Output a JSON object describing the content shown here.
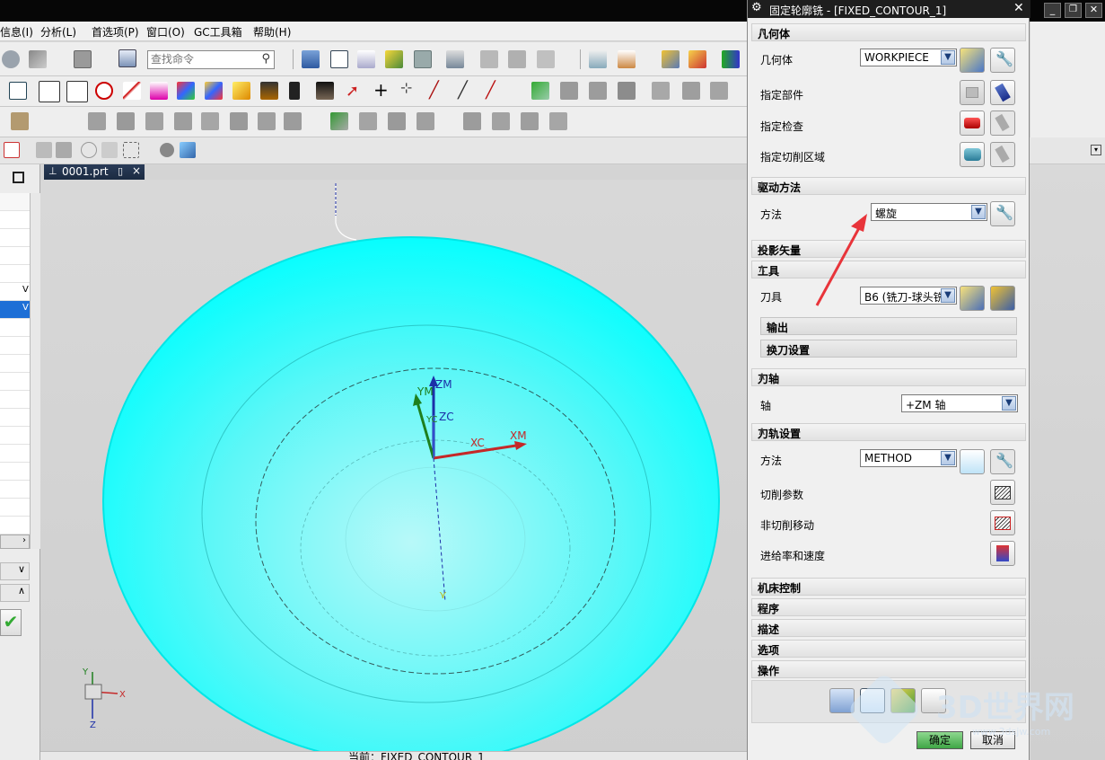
{
  "menu": {
    "items": [
      "信息(I)",
      "分析(L)",
      "首选项(P)",
      "窗口(O)",
      "GC工具箱",
      "帮助(H)"
    ]
  },
  "toolbar": {
    "search_placeholder": "查找命令"
  },
  "tab": {
    "name": "0001.prt"
  },
  "left_panel": {
    "marker1": "V",
    "marker2": "V"
  },
  "viewport": {
    "axes": {
      "zm": "ZM",
      "ym": "YM",
      "zc": "ZC",
      "xc": "XC",
      "xm": "XM",
      "yc": "YC"
    },
    "triad": {
      "x": "X",
      "y": "Y",
      "z": "Z"
    }
  },
  "status": {
    "text": "当前：FIXED_CONTOUR_1"
  },
  "watermark": {
    "text": "3D世界网",
    "url": "www.3dsjw.com"
  },
  "dialog": {
    "title": "固定轮廓铣 - [FIXED_CONTOUR_1]",
    "close_glyph": "✕",
    "sections": {
      "geometry": {
        "title": "几何体",
        "geometry_label": "几何体",
        "geometry_value": "WORKPIECE",
        "part_label": "指定部件",
        "check_label": "指定检查",
        "cut_area_label": "指定切削区域"
      },
      "drive": {
        "title": "驱动方法",
        "method_label": "方法",
        "method_value": "螺旋"
      },
      "projection": {
        "title": "投影矢量"
      },
      "tool": {
        "title": "工具",
        "tool_label": "刀具",
        "tool_value": "B6 (铣刀-球头铣",
        "output": "输出",
        "tool_change": "换刀设置"
      },
      "axis": {
        "title": "刀轴",
        "axis_label": "轴",
        "axis_value": "+ZM 轴"
      },
      "path": {
        "title": "刀轨设置",
        "method_label": "方法",
        "method_value": "METHOD",
        "cut_params": "切削参数",
        "non_cut": "非切削移动",
        "feeds": "进给率和速度"
      },
      "machine": {
        "title": "机床控制"
      },
      "program": {
        "title": "程序"
      },
      "description": {
        "title": "描述"
      },
      "options": {
        "title": "选项"
      },
      "actions": {
        "title": "操作"
      }
    },
    "ok_label": "确定",
    "cancel_label": "取消"
  },
  "colors": {
    "cyan": "#00ffff",
    "dialog_bg": "#f0f0f0",
    "ok_green": "#5fc06a",
    "arrow_red": "#e8343a"
  }
}
